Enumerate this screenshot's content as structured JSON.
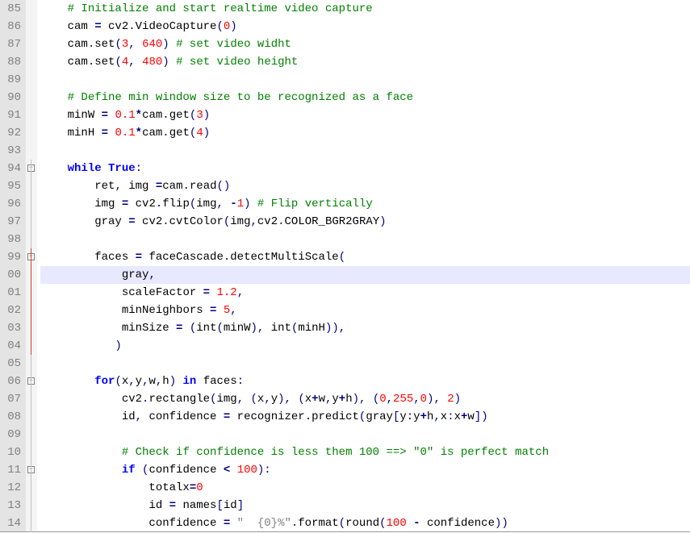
{
  "lines": [
    {
      "num": "85",
      "fold": "none",
      "indent": "    ",
      "hl": false,
      "tokens": [
        {
          "cls": "c-comment",
          "t": "# Initialize and start realtime video capture"
        }
      ]
    },
    {
      "num": "86",
      "fold": "none",
      "indent": "    ",
      "hl": false,
      "tokens": [
        {
          "cls": "c-ident",
          "t": "cam "
        },
        {
          "cls": "c-op",
          "t": "="
        },
        {
          "cls": "c-ident",
          "t": " cv2"
        },
        {
          "cls": "c-punct",
          "t": "."
        },
        {
          "cls": "c-ident",
          "t": "VideoCapture"
        },
        {
          "cls": "c-punct",
          "t": "("
        },
        {
          "cls": "c-number",
          "t": "0"
        },
        {
          "cls": "c-punct",
          "t": ")"
        }
      ]
    },
    {
      "num": "87",
      "fold": "none",
      "indent": "    ",
      "hl": false,
      "tokens": [
        {
          "cls": "c-ident",
          "t": "cam"
        },
        {
          "cls": "c-punct",
          "t": "."
        },
        {
          "cls": "c-ident",
          "t": "set"
        },
        {
          "cls": "c-punct",
          "t": "("
        },
        {
          "cls": "c-number",
          "t": "3"
        },
        {
          "cls": "c-punct",
          "t": ","
        },
        {
          "cls": "c-ident",
          "t": " "
        },
        {
          "cls": "c-number",
          "t": "640"
        },
        {
          "cls": "c-punct",
          "t": ")"
        },
        {
          "cls": "c-ident",
          "t": " "
        },
        {
          "cls": "c-comment",
          "t": "# set video widht"
        }
      ]
    },
    {
      "num": "88",
      "fold": "none",
      "indent": "    ",
      "hl": false,
      "tokens": [
        {
          "cls": "c-ident",
          "t": "cam"
        },
        {
          "cls": "c-punct",
          "t": "."
        },
        {
          "cls": "c-ident",
          "t": "set"
        },
        {
          "cls": "c-punct",
          "t": "("
        },
        {
          "cls": "c-number",
          "t": "4"
        },
        {
          "cls": "c-punct",
          "t": ","
        },
        {
          "cls": "c-ident",
          "t": " "
        },
        {
          "cls": "c-number",
          "t": "480"
        },
        {
          "cls": "c-punct",
          "t": ")"
        },
        {
          "cls": "c-ident",
          "t": " "
        },
        {
          "cls": "c-comment",
          "t": "# set video height"
        }
      ]
    },
    {
      "num": "89",
      "fold": "none",
      "indent": "",
      "hl": false,
      "tokens": []
    },
    {
      "num": "90",
      "fold": "none",
      "indent": "    ",
      "hl": false,
      "tokens": [
        {
          "cls": "c-comment",
          "t": "# Define min window size to be recognized as a face"
        }
      ]
    },
    {
      "num": "91",
      "fold": "none",
      "indent": "    ",
      "hl": false,
      "tokens": [
        {
          "cls": "c-ident",
          "t": "minW "
        },
        {
          "cls": "c-op",
          "t": "="
        },
        {
          "cls": "c-ident",
          "t": " "
        },
        {
          "cls": "c-number",
          "t": "0.1"
        },
        {
          "cls": "c-op",
          "t": "*"
        },
        {
          "cls": "c-ident",
          "t": "cam"
        },
        {
          "cls": "c-punct",
          "t": "."
        },
        {
          "cls": "c-ident",
          "t": "get"
        },
        {
          "cls": "c-punct",
          "t": "("
        },
        {
          "cls": "c-number",
          "t": "3"
        },
        {
          "cls": "c-punct",
          "t": ")"
        }
      ]
    },
    {
      "num": "92",
      "fold": "none",
      "indent": "    ",
      "hl": false,
      "tokens": [
        {
          "cls": "c-ident",
          "t": "minH "
        },
        {
          "cls": "c-op",
          "t": "="
        },
        {
          "cls": "c-ident",
          "t": " "
        },
        {
          "cls": "c-number",
          "t": "0.1"
        },
        {
          "cls": "c-op",
          "t": "*"
        },
        {
          "cls": "c-ident",
          "t": "cam"
        },
        {
          "cls": "c-punct",
          "t": "."
        },
        {
          "cls": "c-ident",
          "t": "get"
        },
        {
          "cls": "c-punct",
          "t": "("
        },
        {
          "cls": "c-number",
          "t": "4"
        },
        {
          "cls": "c-punct",
          "t": ")"
        }
      ]
    },
    {
      "num": "93",
      "fold": "none",
      "indent": "",
      "hl": false,
      "tokens": []
    },
    {
      "num": "94",
      "fold": "open",
      "indent": "    ",
      "hl": false,
      "tokens": [
        {
          "cls": "c-keyword",
          "t": "while"
        },
        {
          "cls": "c-ident",
          "t": " "
        },
        {
          "cls": "c-keyword",
          "t": "True"
        },
        {
          "cls": "c-punct",
          "t": ":"
        }
      ]
    },
    {
      "num": "95",
      "fold": "grey",
      "indent": "        ",
      "hl": false,
      "tokens": [
        {
          "cls": "c-ident",
          "t": "ret"
        },
        {
          "cls": "c-punct",
          "t": ","
        },
        {
          "cls": "c-ident",
          "t": " img "
        },
        {
          "cls": "c-op",
          "t": "="
        },
        {
          "cls": "c-ident",
          "t": "cam"
        },
        {
          "cls": "c-punct",
          "t": "."
        },
        {
          "cls": "c-ident",
          "t": "read"
        },
        {
          "cls": "c-punct",
          "t": "()"
        }
      ]
    },
    {
      "num": "96",
      "fold": "grey",
      "indent": "        ",
      "hl": false,
      "tokens": [
        {
          "cls": "c-ident",
          "t": "img "
        },
        {
          "cls": "c-op",
          "t": "="
        },
        {
          "cls": "c-ident",
          "t": " cv2"
        },
        {
          "cls": "c-punct",
          "t": "."
        },
        {
          "cls": "c-ident",
          "t": "flip"
        },
        {
          "cls": "c-punct",
          "t": "("
        },
        {
          "cls": "c-ident",
          "t": "img"
        },
        {
          "cls": "c-punct",
          "t": ","
        },
        {
          "cls": "c-ident",
          "t": " "
        },
        {
          "cls": "c-op",
          "t": "-"
        },
        {
          "cls": "c-number",
          "t": "1"
        },
        {
          "cls": "c-punct",
          "t": ")"
        },
        {
          "cls": "c-ident",
          "t": " "
        },
        {
          "cls": "c-comment",
          "t": "# Flip vertically"
        }
      ]
    },
    {
      "num": "97",
      "fold": "grey",
      "indent": "        ",
      "hl": false,
      "tokens": [
        {
          "cls": "c-ident",
          "t": "gray "
        },
        {
          "cls": "c-op",
          "t": "="
        },
        {
          "cls": "c-ident",
          "t": " cv2"
        },
        {
          "cls": "c-punct",
          "t": "."
        },
        {
          "cls": "c-ident",
          "t": "cvtColor"
        },
        {
          "cls": "c-punct",
          "t": "("
        },
        {
          "cls": "c-ident",
          "t": "img"
        },
        {
          "cls": "c-punct",
          "t": ","
        },
        {
          "cls": "c-ident",
          "t": "cv2"
        },
        {
          "cls": "c-punct",
          "t": "."
        },
        {
          "cls": "c-ident",
          "t": "COLOR_BGR2GRAY"
        },
        {
          "cls": "c-punct",
          "t": ")"
        }
      ]
    },
    {
      "num": "98",
      "fold": "grey",
      "indent": "",
      "hl": false,
      "tokens": []
    },
    {
      "num": "99",
      "fold": "open-red",
      "indent": "        ",
      "hl": false,
      "tokens": [
        {
          "cls": "c-ident",
          "t": "faces "
        },
        {
          "cls": "c-op",
          "t": "="
        },
        {
          "cls": "c-ident",
          "t": " faceCascade"
        },
        {
          "cls": "c-punct",
          "t": "."
        },
        {
          "cls": "c-ident",
          "t": "detectMultiScale"
        },
        {
          "cls": "c-punct",
          "t": "("
        }
      ]
    },
    {
      "num": "00",
      "fold": "red",
      "indent": "            ",
      "hl": true,
      "tokens": [
        {
          "cls": "c-ident",
          "t": "gray"
        },
        {
          "cls": "c-punct",
          "t": ","
        }
      ]
    },
    {
      "num": "01",
      "fold": "red",
      "indent": "            ",
      "hl": false,
      "tokens": [
        {
          "cls": "c-ident",
          "t": "scaleFactor "
        },
        {
          "cls": "c-op",
          "t": "="
        },
        {
          "cls": "c-ident",
          "t": " "
        },
        {
          "cls": "c-number",
          "t": "1.2"
        },
        {
          "cls": "c-punct",
          "t": ","
        }
      ]
    },
    {
      "num": "02",
      "fold": "red",
      "indent": "            ",
      "hl": false,
      "tokens": [
        {
          "cls": "c-ident",
          "t": "minNeighbors "
        },
        {
          "cls": "c-op",
          "t": "="
        },
        {
          "cls": "c-ident",
          "t": " "
        },
        {
          "cls": "c-number",
          "t": "5"
        },
        {
          "cls": "c-punct",
          "t": ","
        }
      ]
    },
    {
      "num": "03",
      "fold": "red",
      "indent": "            ",
      "hl": false,
      "tokens": [
        {
          "cls": "c-ident",
          "t": "minSize "
        },
        {
          "cls": "c-op",
          "t": "="
        },
        {
          "cls": "c-ident",
          "t": " "
        },
        {
          "cls": "c-punct",
          "t": "("
        },
        {
          "cls": "c-builtin",
          "t": "int"
        },
        {
          "cls": "c-punct",
          "t": "("
        },
        {
          "cls": "c-ident",
          "t": "minW"
        },
        {
          "cls": "c-punct",
          "t": "),"
        },
        {
          "cls": "c-ident",
          "t": " "
        },
        {
          "cls": "c-builtin",
          "t": "int"
        },
        {
          "cls": "c-punct",
          "t": "("
        },
        {
          "cls": "c-ident",
          "t": "minH"
        },
        {
          "cls": "c-punct",
          "t": ")),"
        }
      ]
    },
    {
      "num": "04",
      "fold": "red-end",
      "indent": "           ",
      "hl": false,
      "tokens": [
        {
          "cls": "c-punct",
          "t": ")"
        }
      ]
    },
    {
      "num": "05",
      "fold": "grey",
      "indent": "",
      "hl": false,
      "tokens": []
    },
    {
      "num": "06",
      "fold": "open",
      "indent": "        ",
      "hl": false,
      "tokens": [
        {
          "cls": "c-keyword",
          "t": "for"
        },
        {
          "cls": "c-punct",
          "t": "("
        },
        {
          "cls": "c-ident",
          "t": "x"
        },
        {
          "cls": "c-punct",
          "t": ","
        },
        {
          "cls": "c-ident",
          "t": "y"
        },
        {
          "cls": "c-punct",
          "t": ","
        },
        {
          "cls": "c-ident",
          "t": "w"
        },
        {
          "cls": "c-punct",
          "t": ","
        },
        {
          "cls": "c-ident",
          "t": "h"
        },
        {
          "cls": "c-punct",
          "t": ")"
        },
        {
          "cls": "c-ident",
          "t": " "
        },
        {
          "cls": "c-keyword",
          "t": "in"
        },
        {
          "cls": "c-ident",
          "t": " faces"
        },
        {
          "cls": "c-punct",
          "t": ":"
        }
      ]
    },
    {
      "num": "07",
      "fold": "grey",
      "indent": "            ",
      "hl": false,
      "tokens": [
        {
          "cls": "c-ident",
          "t": "cv2"
        },
        {
          "cls": "c-punct",
          "t": "."
        },
        {
          "cls": "c-ident",
          "t": "rectangle"
        },
        {
          "cls": "c-punct",
          "t": "("
        },
        {
          "cls": "c-ident",
          "t": "img"
        },
        {
          "cls": "c-punct",
          "t": ","
        },
        {
          "cls": "c-ident",
          "t": " "
        },
        {
          "cls": "c-punct",
          "t": "("
        },
        {
          "cls": "c-ident",
          "t": "x"
        },
        {
          "cls": "c-punct",
          "t": ","
        },
        {
          "cls": "c-ident",
          "t": "y"
        },
        {
          "cls": "c-punct",
          "t": "),"
        },
        {
          "cls": "c-ident",
          "t": " "
        },
        {
          "cls": "c-punct",
          "t": "("
        },
        {
          "cls": "c-ident",
          "t": "x"
        },
        {
          "cls": "c-op",
          "t": "+"
        },
        {
          "cls": "c-ident",
          "t": "w"
        },
        {
          "cls": "c-punct",
          "t": ","
        },
        {
          "cls": "c-ident",
          "t": "y"
        },
        {
          "cls": "c-op",
          "t": "+"
        },
        {
          "cls": "c-ident",
          "t": "h"
        },
        {
          "cls": "c-punct",
          "t": "),"
        },
        {
          "cls": "c-ident",
          "t": " "
        },
        {
          "cls": "c-punct",
          "t": "("
        },
        {
          "cls": "c-number",
          "t": "0"
        },
        {
          "cls": "c-punct",
          "t": ","
        },
        {
          "cls": "c-number",
          "t": "255"
        },
        {
          "cls": "c-punct",
          "t": ","
        },
        {
          "cls": "c-number",
          "t": "0"
        },
        {
          "cls": "c-punct",
          "t": "),"
        },
        {
          "cls": "c-ident",
          "t": " "
        },
        {
          "cls": "c-number",
          "t": "2"
        },
        {
          "cls": "c-punct",
          "t": ")"
        }
      ]
    },
    {
      "num": "08",
      "fold": "grey",
      "indent": "            ",
      "hl": false,
      "tokens": [
        {
          "cls": "c-ident",
          "t": "id"
        },
        {
          "cls": "c-punct",
          "t": ","
        },
        {
          "cls": "c-ident",
          "t": " confidence "
        },
        {
          "cls": "c-op",
          "t": "="
        },
        {
          "cls": "c-ident",
          "t": " recognizer"
        },
        {
          "cls": "c-punct",
          "t": "."
        },
        {
          "cls": "c-ident",
          "t": "predict"
        },
        {
          "cls": "c-punct",
          "t": "("
        },
        {
          "cls": "c-ident",
          "t": "gray"
        },
        {
          "cls": "c-punct",
          "t": "["
        },
        {
          "cls": "c-ident",
          "t": "y"
        },
        {
          "cls": "c-punct",
          "t": ":"
        },
        {
          "cls": "c-ident",
          "t": "y"
        },
        {
          "cls": "c-op",
          "t": "+"
        },
        {
          "cls": "c-ident",
          "t": "h"
        },
        {
          "cls": "c-punct",
          "t": ","
        },
        {
          "cls": "c-ident",
          "t": "x"
        },
        {
          "cls": "c-punct",
          "t": ":"
        },
        {
          "cls": "c-ident",
          "t": "x"
        },
        {
          "cls": "c-op",
          "t": "+"
        },
        {
          "cls": "c-ident",
          "t": "w"
        },
        {
          "cls": "c-punct",
          "t": "])"
        }
      ]
    },
    {
      "num": "09",
      "fold": "grey",
      "indent": "",
      "hl": false,
      "tokens": []
    },
    {
      "num": "10",
      "fold": "grey",
      "indent": "            ",
      "hl": false,
      "tokens": [
        {
          "cls": "c-comment",
          "t": "# Check if confidence is less them 100 ==> \"0\" is perfect match"
        }
      ]
    },
    {
      "num": "11",
      "fold": "open",
      "indent": "            ",
      "hl": false,
      "tokens": [
        {
          "cls": "c-keyword",
          "t": "if"
        },
        {
          "cls": "c-ident",
          "t": " "
        },
        {
          "cls": "c-punct",
          "t": "("
        },
        {
          "cls": "c-ident",
          "t": "confidence "
        },
        {
          "cls": "c-op",
          "t": "<"
        },
        {
          "cls": "c-ident",
          "t": " "
        },
        {
          "cls": "c-number",
          "t": "100"
        },
        {
          "cls": "c-punct",
          "t": "):"
        }
      ]
    },
    {
      "num": "12",
      "fold": "grey",
      "indent": "                ",
      "hl": false,
      "tokens": [
        {
          "cls": "c-ident",
          "t": "totalx"
        },
        {
          "cls": "c-op",
          "t": "="
        },
        {
          "cls": "c-number",
          "t": "0"
        }
      ]
    },
    {
      "num": "13",
      "fold": "grey",
      "indent": "                ",
      "hl": false,
      "tokens": [
        {
          "cls": "c-ident",
          "t": "id "
        },
        {
          "cls": "c-op",
          "t": "="
        },
        {
          "cls": "c-ident",
          "t": " names"
        },
        {
          "cls": "c-punct",
          "t": "["
        },
        {
          "cls": "c-ident",
          "t": "id"
        },
        {
          "cls": "c-punct",
          "t": "]"
        }
      ]
    },
    {
      "num": "14",
      "fold": "grey",
      "indent": "                ",
      "hl": false,
      "tokens": [
        {
          "cls": "c-ident",
          "t": "confidence "
        },
        {
          "cls": "c-op",
          "t": "="
        },
        {
          "cls": "c-ident",
          "t": " "
        },
        {
          "cls": "c-string",
          "t": "\"  {0}%\""
        },
        {
          "cls": "c-punct",
          "t": "."
        },
        {
          "cls": "c-ident",
          "t": "format"
        },
        {
          "cls": "c-punct",
          "t": "("
        },
        {
          "cls": "c-builtin",
          "t": "round"
        },
        {
          "cls": "c-punct",
          "t": "("
        },
        {
          "cls": "c-number",
          "t": "100"
        },
        {
          "cls": "c-ident",
          "t": " "
        },
        {
          "cls": "c-op",
          "t": "-"
        },
        {
          "cls": "c-ident",
          "t": " confidence"
        },
        {
          "cls": "c-punct",
          "t": "))"
        }
      ]
    }
  ]
}
